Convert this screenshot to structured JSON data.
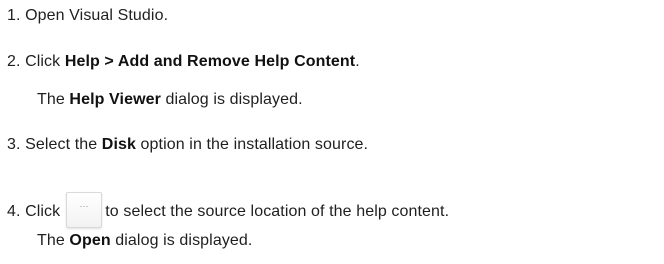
{
  "steps": [
    {
      "number": "1.",
      "text": "Open Visual Studio."
    },
    {
      "number": "2.",
      "pre": "Click ",
      "bold": "Help > Add and Remove Help Content",
      "post": ".",
      "note": {
        "pre": "The ",
        "bold": "Help Viewer",
        "post": " dialog is displayed."
      }
    },
    {
      "number": "3.",
      "pre": "Select the ",
      "bold": "Disk",
      "post": " option in the installation source."
    },
    {
      "number": "4.",
      "pre": "Click",
      "button_glyph": "...",
      "post": "to select the source location of the help content.",
      "note": {
        "pre": "The ",
        "bold": "Open",
        "post": " dialog is displayed."
      }
    }
  ]
}
